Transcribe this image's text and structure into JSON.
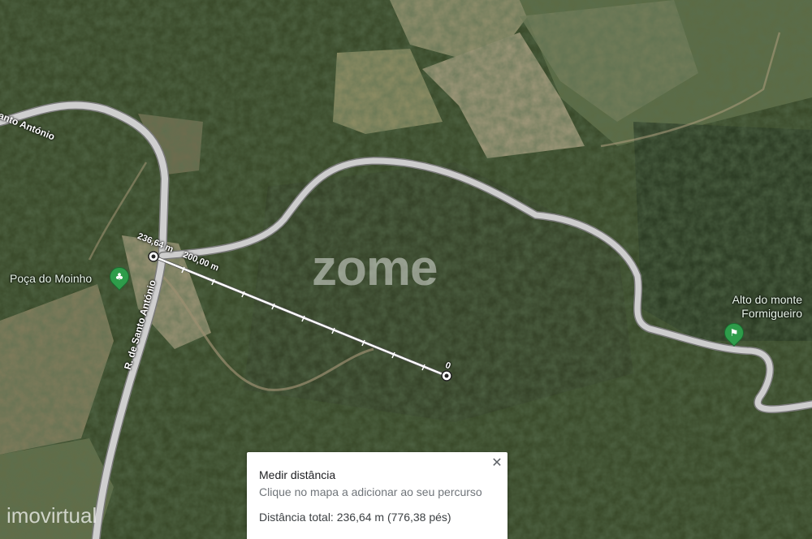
{
  "map": {
    "road_labels": {
      "top_left": "Santo António",
      "vertical": "R. de Santo António"
    },
    "pois": [
      {
        "name": "Poça do Moinho",
        "icon": "park-icon"
      },
      {
        "name": "Alto do monte Formigueiro",
        "icon": "hiking-icon"
      }
    ],
    "measurement": {
      "start_label": "236,64 m",
      "mid_label": "200,00 m",
      "end_label": "0"
    },
    "watermarks": {
      "center": "zome",
      "bottom_left": "imovirtual"
    },
    "colors": {
      "road": "#c8c8c8",
      "measure_line": "#ffffff",
      "poi_green": "#2e9c4a"
    }
  },
  "panel": {
    "title": "Medir distância",
    "hint": "Clique no mapa a adicionar ao seu percurso",
    "total": "Distância total: 236,64 m (776,38 pés)",
    "close_icon": "close-icon"
  }
}
